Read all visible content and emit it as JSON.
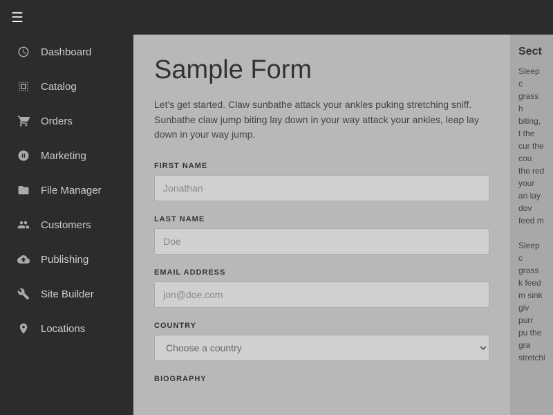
{
  "topbar": {
    "menu_icon": "☰"
  },
  "sidebar": {
    "items": [
      {
        "id": "dashboard",
        "label": "Dashboard",
        "icon": "dashboard"
      },
      {
        "id": "catalog",
        "label": "Catalog",
        "icon": "catalog"
      },
      {
        "id": "orders",
        "label": "Orders",
        "icon": "orders"
      },
      {
        "id": "marketing",
        "label": "Marketing",
        "icon": "marketing"
      },
      {
        "id": "file-manager",
        "label": "File Manager",
        "icon": "file-manager"
      },
      {
        "id": "customers",
        "label": "Customers",
        "icon": "customers"
      },
      {
        "id": "publishing",
        "label": "Publishing",
        "icon": "publishing"
      },
      {
        "id": "site-builder",
        "label": "Site Builder",
        "icon": "site-builder"
      },
      {
        "id": "locations",
        "label": "Locations",
        "icon": "locations"
      }
    ]
  },
  "form": {
    "title": "Sample Form",
    "intro": "Let's get started. Claw sunbathe attack your ankles puking stretching sniff. Sunbathe claw jump biting lay down in your way attack your ankles, leap lay down in your way jump.",
    "fields": {
      "first_name": {
        "label": "FIRST NAME",
        "placeholder": "Jonathan",
        "value": ""
      },
      "last_name": {
        "label": "LAST NAME",
        "placeholder": "Doe",
        "value": ""
      },
      "email": {
        "label": "EMAIL ADDRESS",
        "placeholder": "jon@doe.com",
        "value": ""
      },
      "country": {
        "label": "COUNTRY",
        "placeholder": "Choose a country",
        "value": ""
      },
      "biography": {
        "label": "BIOGRAPHY"
      }
    }
  },
  "right_panel": {
    "section_title": "Sect",
    "text1": "Sleep c grass h biting, t the cur the cou the red your an lay dov feed m",
    "text2": "Sleep c grass k feed m sink giv purr pu the gra stretchi"
  }
}
